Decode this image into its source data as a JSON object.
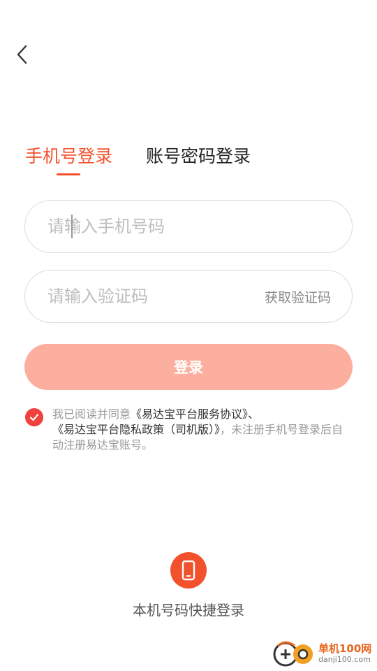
{
  "tabs": [
    {
      "label": "手机号登录",
      "active": true
    },
    {
      "label": "账号密码登录",
      "active": false
    }
  ],
  "phone_field": {
    "placeholder": "请输入手机号码",
    "value": ""
  },
  "code_field": {
    "placeholder": "请输入验证码",
    "value": "",
    "get_code_label": "获取验证码"
  },
  "login_button": {
    "label": "登录"
  },
  "agreement": {
    "checked": true,
    "prefix": "我已阅读并同意",
    "service_link": "《易达宝平台服务协议》、",
    "privacy_link": "《易达宝平台隐私政策（司机版）》",
    "suffix": "，未注册手机号登录后自动注册易达宝账号。"
  },
  "quick_login": {
    "label": "本机号码快捷登录",
    "icon": "phone-icon"
  },
  "watermark": {
    "cn": "单机100网",
    "url": "danji100.com"
  },
  "colors": {
    "accent": "#f2522b",
    "login_button_bg": "#fdaf9f",
    "check_bg": "#f0413c",
    "placeholder": "#bdbdbd"
  }
}
